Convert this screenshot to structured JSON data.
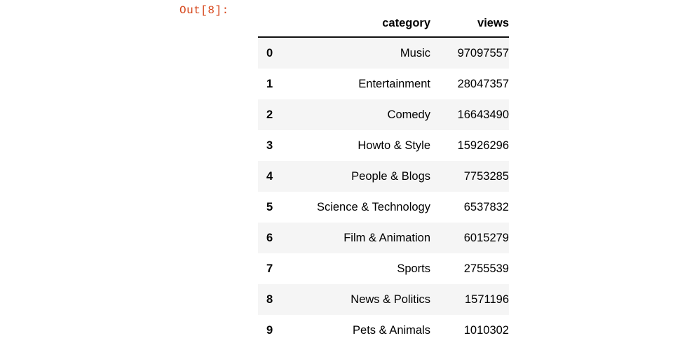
{
  "prompt": {
    "label": "Out[8]:",
    "color": "#D64418"
  },
  "table": {
    "columns": {
      "index": "",
      "category": "category",
      "views": "views"
    },
    "rows": [
      {
        "index": "0",
        "category": "Music",
        "views": "97097557"
      },
      {
        "index": "1",
        "category": "Entertainment",
        "views": "28047357"
      },
      {
        "index": "2",
        "category": "Comedy",
        "views": "16643490"
      },
      {
        "index": "3",
        "category": "Howto & Style",
        "views": "15926296"
      },
      {
        "index": "4",
        "category": "People & Blogs",
        "views": "7753285"
      },
      {
        "index": "5",
        "category": "Science & Technology",
        "views": "6537832"
      },
      {
        "index": "6",
        "category": "Film & Animation",
        "views": "6015279"
      },
      {
        "index": "7",
        "category": "Sports",
        "views": "2755539"
      },
      {
        "index": "8",
        "category": "News & Politics",
        "views": "1571196"
      },
      {
        "index": "9",
        "category": "Pets & Animals",
        "views": "1010302"
      }
    ]
  },
  "style": {
    "stripe_color": "#F5F5F5",
    "background_color": "#FFFFFF",
    "text_color": "#000000",
    "header_rule_color": "#111111"
  }
}
